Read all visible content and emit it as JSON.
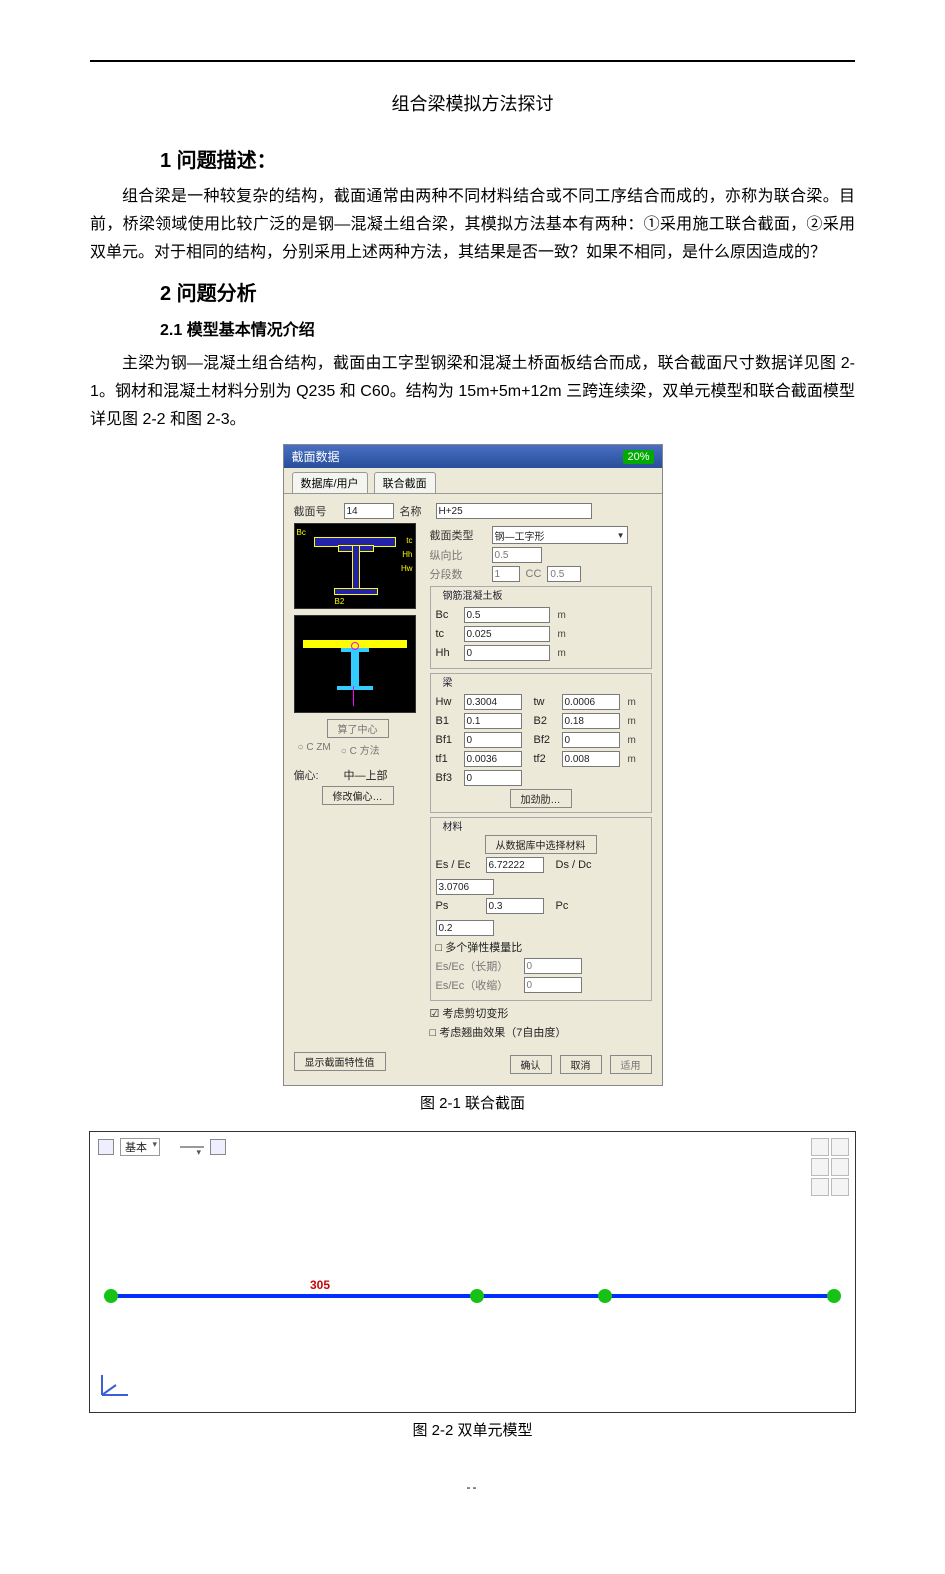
{
  "doc": {
    "title": "组合梁模拟方法探讨",
    "h1_1": "1 问题描述：",
    "p1": "组合梁是一种较复杂的结构，截面通常由两种不同材料结合或不同工序结合而成的，亦称为联合梁。目前，桥梁领域使用比较广泛的是钢—混凝土组合梁，其模拟方法基本有两种：①采用施工联合截面，②采用双单元。对于相同的结构，分别采用上述两种方法，其结果是否一致？如果不相同，是什么原因造成的？",
    "h1_2": "2 问题分析",
    "h2_21": "2.1 模型基本情况介绍",
    "p2": "主梁为钢—混凝土组合结构，截面由工字型钢梁和混凝土桥面板结合而成，联合截面尺寸数据详见图 2-1。钢材和混凝土材料分别为 Q235 和 C60。结构为 15m+5m+12m 三跨连续梁，双单元模型和联合截面模型详见图 2-2 和图 2-3。",
    "cap21": "图 2-1  联合截面",
    "cap22": "图 2-2  双单元模型"
  },
  "dlg": {
    "title": "截面数据",
    "badge": "20%",
    "tabs": [
      "数据库/用户",
      "联合截面"
    ],
    "idLabel": "截面号",
    "idValue": "14",
    "nameLabel": "名称",
    "nameValue": "H+25",
    "secTypeLabel": "截面类型",
    "secTypeValue": "钢—工字形",
    "ratioLabel": "纵向比",
    "ratioValue": "0.5",
    "segLabel": "分段数",
    "segA": "1",
    "segCC": "CC",
    "segB": "0.5",
    "slabGroup": "钢筋混凝土板",
    "slab": {
      "Bc": "0.5",
      "tc": "0.025",
      "Hh": "0"
    },
    "beamGroup": "梁",
    "beam": {
      "Hw": "0.3004",
      "tw": "0.0006",
      "B1": "0.1",
      "B2": "0.18",
      "Bf1": "0",
      "Bf2": "0",
      "tf1": "0.0036",
      "tf2": "0.008",
      "Bf3": "0"
    },
    "addStiff": "加劲肋…",
    "matGroup": "材料",
    "matNote": "从数据库中选择材料",
    "mat": {
      "EsEc": "6.72222",
      "DsDc": "3.0706",
      "Ps": "0.3",
      "Pc": "0.2"
    },
    "multiE": "多个弹性模量比",
    "EsEcLong": "Es/Ec（长期）",
    "EsEcLongV": "0",
    "EsEcShr": "Es/Ec（收缩）",
    "EsEcShrV": "0",
    "offsetLabel": "偏心:",
    "offsetValue": "中—上部",
    "changeOffset": "修改偏心…",
    "considerShear": "考虑剪切变形",
    "considerWarp": "考虑翘曲效果（7自由度）",
    "showProps": "显示截面特性值",
    "ok": "确认",
    "cancel": "取消",
    "apply": "适用",
    "calcCentroid": "算了中心",
    "rCZM": "C ZM",
    "rCFA": "C 方法"
  },
  "fig22": {
    "layerLabel": "基本",
    "dim": "305"
  }
}
